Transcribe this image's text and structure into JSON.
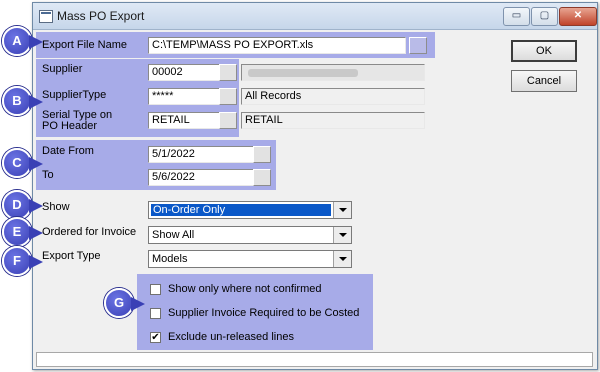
{
  "window": {
    "title": "Mass PO Export",
    "controls": {
      "minimize": "▭",
      "maximize": "▢",
      "close": "✕"
    }
  },
  "callouts": [
    "A",
    "B",
    "C",
    "D",
    "E",
    "F",
    "G"
  ],
  "form": {
    "export_file": {
      "label": "Export File Name",
      "value": "C:\\TEMP\\MASS PO EXPORT.xls"
    },
    "supplier": {
      "label": "Supplier",
      "value": "00002"
    },
    "supplier_type": {
      "label": "SupplierType",
      "value": "*****",
      "description": "All Records"
    },
    "serial_type": {
      "label_line1": "Serial Type on",
      "label_line2": "PO Header",
      "value": "RETAIL",
      "description": "RETAIL"
    },
    "date_from": {
      "label": "Date From",
      "value": "5/1/2022"
    },
    "date_to": {
      "label": "To",
      "value": "5/6/2022"
    },
    "show": {
      "label": "Show",
      "value": "On-Order Only"
    },
    "ordered_for_invoice": {
      "label": "Ordered for Invoice",
      "value": "Show All"
    },
    "export_type": {
      "label": "Export Type",
      "value": "Models"
    }
  },
  "options": [
    {
      "label": "Show only where not confirmed",
      "checked": false
    },
    {
      "label": "Supplier Invoice Required to be Costed",
      "checked": false
    },
    {
      "label": "Exclude un-released  lines",
      "checked": true
    }
  ],
  "buttons": {
    "ok": "OK",
    "cancel": "Cancel"
  },
  "colors": {
    "highlight": "#a7abe8",
    "callout": "#3a40b5",
    "selection": "#0a58c8"
  }
}
